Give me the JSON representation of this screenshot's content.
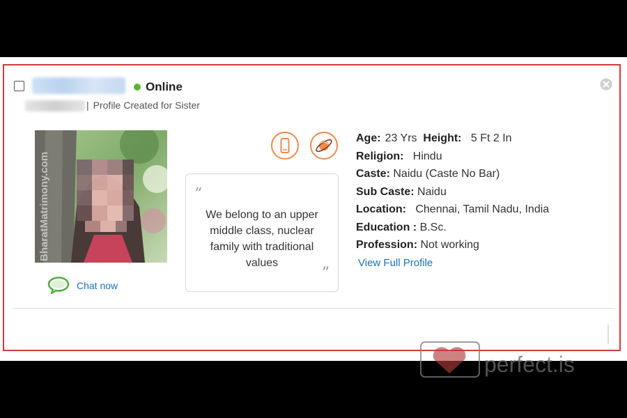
{
  "profile": {
    "status": "Online",
    "created_for": "Profile Created for Sister",
    "separator": "|",
    "photo_watermark": "BharatMatrimony.com",
    "chat_label": "Chat now",
    "about_quote": "We belong to an upper middle class, nuclear family with traditional values",
    "quote_open": "“",
    "quote_close": "”",
    "details": {
      "age_label": "Age:",
      "age_value": "23 Yrs",
      "height_label": "Height:",
      "height_value": "5 Ft 2 In",
      "religion_label": "Religion:",
      "religion_value": "Hindu",
      "caste_label": "Caste:",
      "caste_value": "Naidu (Caste No Bar)",
      "subcaste_label": "Sub Caste:",
      "subcaste_value": "Naidu",
      "location_label": "Location:",
      "location_value": "Chennai, Tamil Nadu, India",
      "education_label": "Education :",
      "education_value": "B.Sc.",
      "profession_label": "Profession:",
      "profession_value": "Not working"
    },
    "view_full_profile": "View Full Profile"
  },
  "icons": {
    "close": "close-icon",
    "phone": "phone-icon",
    "astro": "planet-icon",
    "chat": "chat-bubble-icon"
  },
  "colors": {
    "card_border": "#d23a3a",
    "online": "#5cb534",
    "link": "#1a73b8",
    "accent_orange": "#f08a4b"
  },
  "site_watermark": "perfect.is"
}
